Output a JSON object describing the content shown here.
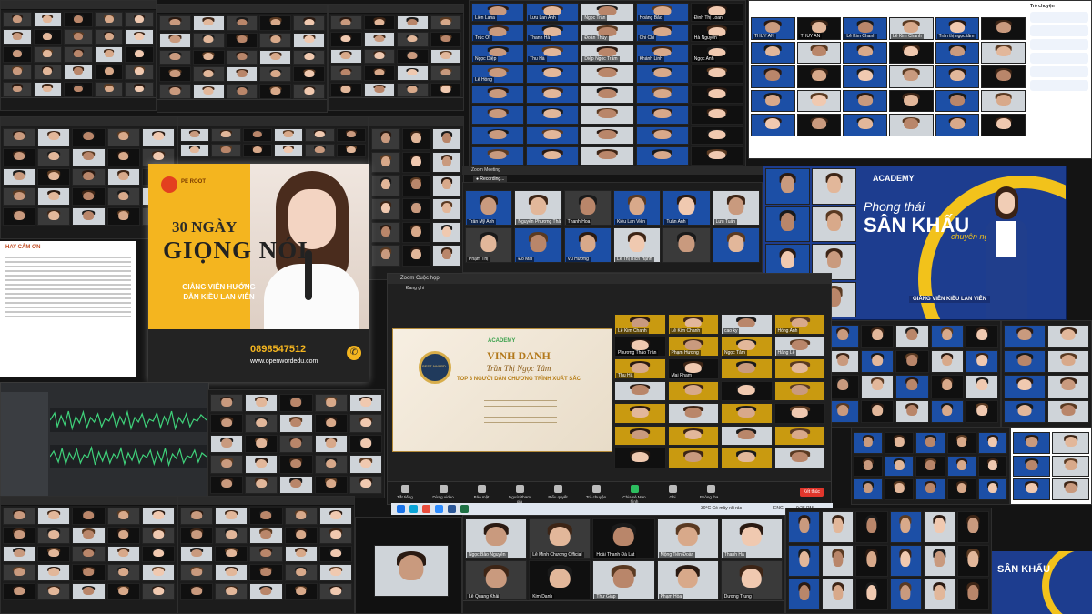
{
  "poster": {
    "brand": "PE ROOT",
    "title_line1": "30 NGÀY",
    "title_line2": "GIỌNG NÓI",
    "subtitle": "GIẢNG VIÊN HƯỚNG DẪN KIỀU LAN VIÊN",
    "phone": "0898547512",
    "website": "www.openwordedu.com"
  },
  "stage_banner": {
    "brand": "ACADEMY",
    "phong_thai": "Phong thái",
    "san_khau": "SÂN KHẤU",
    "chuyen_nghiep": "chuyên nghiệp",
    "instructor": "GIẢNG VIÊN KIỀU LAN VIÊN"
  },
  "slide": {
    "academy": "ACADEMY",
    "vinh_danh": "VINH DANH",
    "name": "Trần Thị Ngọc Tâm",
    "top3": "TOP 3 NGƯỜI DẪN CHƯƠNG TRÌNH XUẤT SẮC",
    "medal": "BEST AWARD"
  },
  "zoom_window": {
    "title": "Zoom Cuộc họp",
    "recording": "Đang ghi",
    "zoom_meeting": "Zoom Meeting",
    "end_button": "Kết thúc",
    "controls": [
      "Tắt tiếng",
      "Dừng video",
      "Bảo mật",
      "Người tham gia",
      "Biểu quyết",
      "Trò chuyện",
      "Chia sẻ Màn hình",
      "Ghi",
      "Phòng tha..."
    ]
  },
  "gallery_names": [
    "Lê Kim Chanh",
    "Lê Kim Chanh",
    "cao ky",
    "Hồng Anh",
    "Phương Thảo Trần",
    "Phạm Hương",
    "Ngọc Tâm",
    "Hằng Lê",
    "Thu Hà",
    "Mai Phạm"
  ],
  "top_gallery_names": [
    "Liên Lana",
    "Lưu Lan Anh",
    "Ngọc Trần",
    "Hoàng Bảo",
    "Đinh Thị Loan",
    "Trúc Ơi",
    "Thanh Hà",
    "Đoàn Thúy",
    "Chi Chi",
    "Hà Nguyễn",
    "Ngọc Diệp",
    "Thu Hà",
    "Diệp Ngọc Trâm",
    "Khánh Linh",
    "Ngọc Anh",
    "Lê Hồng"
  ],
  "mid_gallery_names": [
    "Trần Mỹ Anh",
    "Nguyễn Phương Thảo",
    "Thanh Hoa",
    "Kiều Lan Viên",
    "Tuấn Anh",
    "Lưu Tuấn",
    "Phạm Thị",
    "Đỗ Mai",
    "Vũ Hương",
    "Lê Thị Bích Hạnh"
  ],
  "right_gallery_names": [
    "THÚY AN",
    "THÚY AN",
    "Lê Kim Chanh",
    "Lê Kim Chanh",
    "Trần thị ngọc tâm"
  ],
  "bottom_gallery_names": [
    "Ngọc Bảo Nguyên",
    "Lê Minh Chương Official",
    "Hoài Thanh Đà Lạt",
    "Mộng Tiên Đoàn",
    "Thanh Hà",
    "Lê Quang Khải",
    "Kim Danh",
    "Thư Giáp",
    "Phạm Hòa",
    "Dương Trung"
  ],
  "chat_title": "Trò chuyện",
  "taskbar": {
    "weather": "30°C Có mây rải rác",
    "lang": "ENG",
    "time": "9:25 PM"
  },
  "doc_header": "HAY CẢM ƠN",
  "colors": {
    "zoom_dark": "#1c1c1c",
    "poster_yellow": "#f4b51f",
    "stage_blue": "#1d3d8f",
    "end_red": "#e0362c",
    "share_green": "#2dbe60"
  }
}
